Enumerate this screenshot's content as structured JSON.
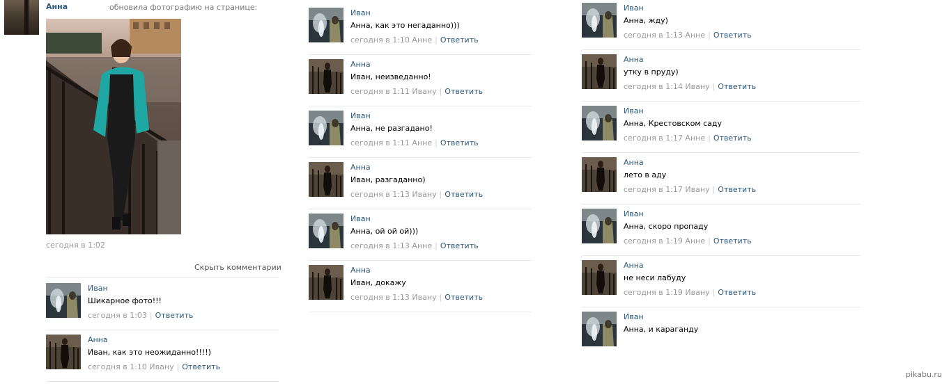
{
  "post": {
    "author": "Анна",
    "action": "обновила фотографию на странице:",
    "time": "сегодня в 1:02",
    "hide_comments": "Скрыть комментарии"
  },
  "reply_label": "Ответить",
  "columns": [
    [
      {
        "author": "Иван",
        "text": "Шикарное фото!!!",
        "time": "сегодня в 1:03",
        "to": "",
        "avatar": "ivan"
      },
      {
        "author": "Анна",
        "text": "Иван, как это неожиданно!!!!)",
        "time": "сегодня в 1:10",
        "to": "Ивану",
        "avatar": "anna"
      }
    ],
    [
      {
        "author": "Иван",
        "text": "Анна, как это негаданно)))",
        "time": "сегодня в 1:10",
        "to": "Анне",
        "avatar": "ivan"
      },
      {
        "author": "Анна",
        "text": "Иван, неизведанно!",
        "time": "сегодня в 1:11",
        "to": "Ивану",
        "avatar": "anna"
      },
      {
        "author": "Иван",
        "text": "Анна, не разгадано!",
        "time": "сегодня в 1:11",
        "to": "Анне",
        "avatar": "ivan"
      },
      {
        "author": "Анна",
        "text": "Иван, разгаданно)",
        "time": "сегодня в 1:13",
        "to": "Ивану",
        "avatar": "anna"
      },
      {
        "author": "Иван",
        "text": "Анна, ой ой ой)))",
        "time": "сегодня в 1:13",
        "to": "Анне",
        "avatar": "ivan"
      },
      {
        "author": "Анна",
        "text": "Иван, докажу",
        "time": "сегодня в 1:13",
        "to": "Ивану",
        "avatar": "anna"
      }
    ],
    [
      {
        "author": "Иван",
        "text": "Анна, жду)",
        "time": "сегодня в 1:13",
        "to": "Анне",
        "avatar": "ivan"
      },
      {
        "author": "Анна",
        "text": "утку в пруду)",
        "time": "сегодня в 1:14",
        "to": "Ивану",
        "avatar": "anna"
      },
      {
        "author": "Иван",
        "text": "Анна, Крестовском саду",
        "time": "сегодня в 1:17",
        "to": "Анне",
        "avatar": "ivan"
      },
      {
        "author": "Анна",
        "text": "лето в аду",
        "time": "сегодня в 1:17",
        "to": "Ивану",
        "avatar": "anna"
      },
      {
        "author": "Иван",
        "text": "Анна, скоро пропаду",
        "time": "сегодня в 1:19",
        "to": "Анне",
        "avatar": "ivan"
      },
      {
        "author": "Анна",
        "text": "не неси лабуду",
        "time": "сегодня в 1:19",
        "to": "Ивану",
        "avatar": "anna"
      },
      {
        "author": "Иван",
        "text": "Анна, и караганду",
        "time": "",
        "to": "",
        "avatar": "ivan"
      }
    ]
  ],
  "watermark": "pikabu.ru"
}
